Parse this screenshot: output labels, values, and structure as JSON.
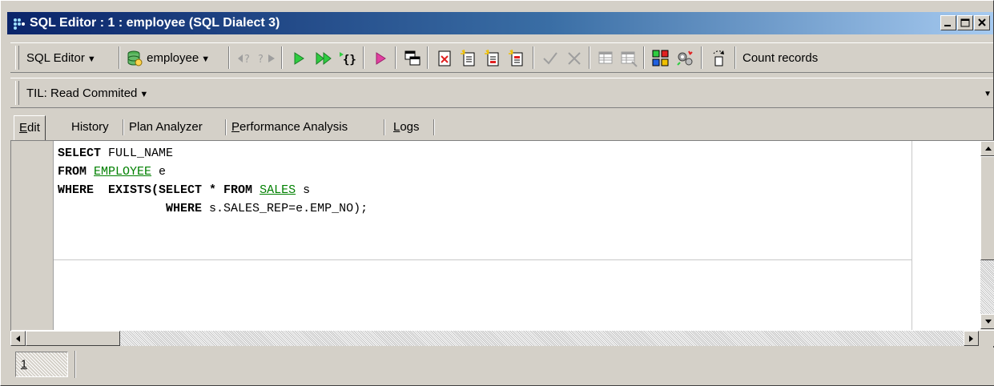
{
  "window": {
    "title": "SQL Editor : 1 : employee (SQL Dialect 3)"
  },
  "toolbar": {
    "sql_editor_menu": "SQL Editor",
    "database_menu": "employee",
    "count_records": "Count records",
    "til_menu": "TIL: Read Commited"
  },
  "tabs": [
    {
      "label": "Edit",
      "accel": "E",
      "rest": "dit",
      "active": true
    },
    {
      "label": "History"
    },
    {
      "label": "Plan Analyzer"
    },
    {
      "label": "Performance Analysis",
      "accel": "P",
      "rest": "erformance Analysis"
    },
    {
      "label": "Logs",
      "accel": "L",
      "rest": "ogs"
    }
  ],
  "editor": {
    "lines": [
      [
        {
          "t": "SELECT",
          "k": "kw"
        },
        {
          "t": " FULL_NAME",
          "k": ""
        }
      ],
      [
        {
          "t": "FROM",
          "k": "kw"
        },
        {
          "t": " ",
          "k": ""
        },
        {
          "t": "EMPLOYEE",
          "k": "tbl"
        },
        {
          "t": " e",
          "k": ""
        }
      ],
      [
        {
          "t": "WHERE",
          "k": "kw"
        },
        {
          "t": "  ",
          "k": ""
        },
        {
          "t": "EXISTS(SELECT * FROM",
          "k": "kw"
        },
        {
          "t": " ",
          "k": ""
        },
        {
          "t": "SALES",
          "k": "tbl"
        },
        {
          "t": " s",
          "k": ""
        }
      ],
      [
        {
          "t": "               ",
          "k": ""
        },
        {
          "t": "WHERE",
          "k": "kw"
        },
        {
          "t": " s.SALES_REP=e.EMP_NO);",
          "k": ""
        }
      ]
    ]
  },
  "statusbar": {
    "pane1": "1"
  },
  "colors": {
    "titlebar_start": "#0a246a",
    "titlebar_end": "#a6caf0",
    "table_link": "#008000",
    "chrome": "#d4d0c8"
  }
}
